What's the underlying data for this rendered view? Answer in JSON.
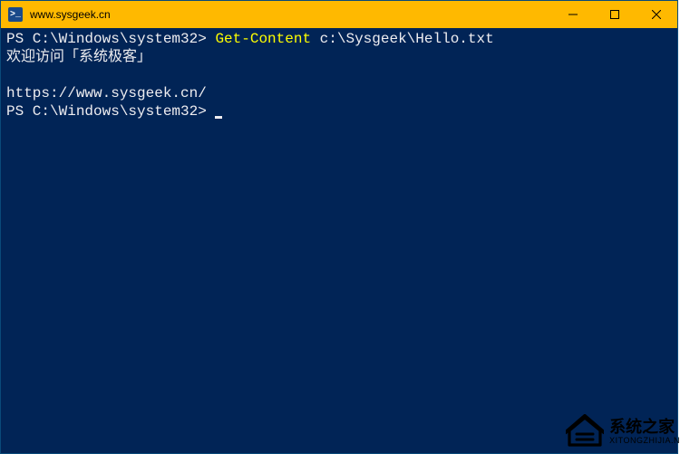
{
  "window": {
    "title": "www.sysgeek.cn",
    "icon_glyph": ">_"
  },
  "controls": {
    "minimize": "minimize",
    "maximize": "maximize",
    "close": "close"
  },
  "terminal": {
    "line1_prompt": "PS C:\\Windows\\system32> ",
    "line1_cmd": "Get-Content",
    "line1_arg": " c:\\Sysgeek\\Hello.txt",
    "line2": "欢迎访问「系统极客」",
    "line3": "",
    "line4": "https://www.sysgeek.cn/",
    "line5_prompt": "PS C:\\Windows\\system32> "
  },
  "watermark": {
    "name_cn": "系统之家",
    "name_en": "XITONGZHIJIA.N"
  }
}
